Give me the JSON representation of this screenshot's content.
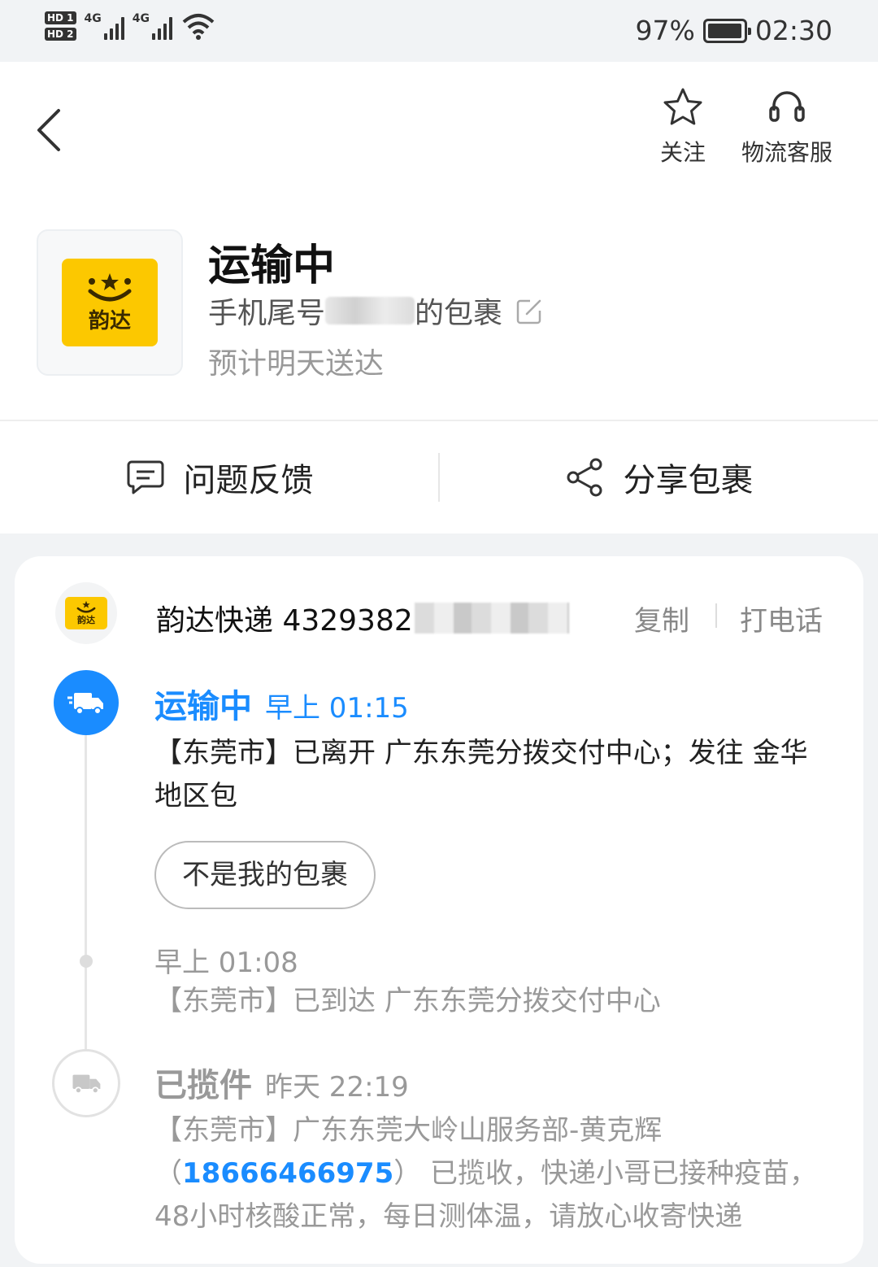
{
  "status_bar": {
    "sim1": "HD 1",
    "sim2": "HD 2",
    "net1": "4G",
    "net2": "4G",
    "battery_percent": "97%",
    "battery_level": 0.97,
    "time": "02:30"
  },
  "header": {
    "follow_label": "关注",
    "support_label": "物流客服"
  },
  "package": {
    "status": "运输中",
    "title_prefix": "手机尾号",
    "title_suffix": "的包裹",
    "eta": "预计明天送达",
    "logo_text": "韵达"
  },
  "actions": {
    "feedback_label": "问题反馈",
    "share_label": "分享包裹"
  },
  "courier": {
    "logo_text": "韵达",
    "tracking_text": "韵达快递 4329382",
    "copy_label": "复制",
    "call_label": "打电话"
  },
  "timeline": [
    {
      "status": "运输中",
      "time": "早上 01:15",
      "desc": "【东莞市】已离开 广东东莞分拨交付中心；发往 金华地区包",
      "button": "不是我的包裹"
    },
    {
      "time": "早上 01:08",
      "desc": "【东莞市】已到达 广东东莞分拨交付中心"
    },
    {
      "status": "已揽件",
      "time": "昨天 22:19",
      "desc_prefix": "【东莞市】广东东莞大岭山服务部-黄克辉（",
      "phone": "18666466975",
      "desc_suffix": "） 已揽收，快递小哥已接种疫苗，48小时核酸正常，每日测体温，请放心收寄快递"
    }
  ],
  "colors": {
    "accent_blue": "#1a8cff",
    "brand_yellow": "#fcc800"
  },
  "icons": [
    "back-icon",
    "star-icon",
    "headset-icon",
    "comment-icon",
    "share-icon",
    "truck-icon"
  ]
}
